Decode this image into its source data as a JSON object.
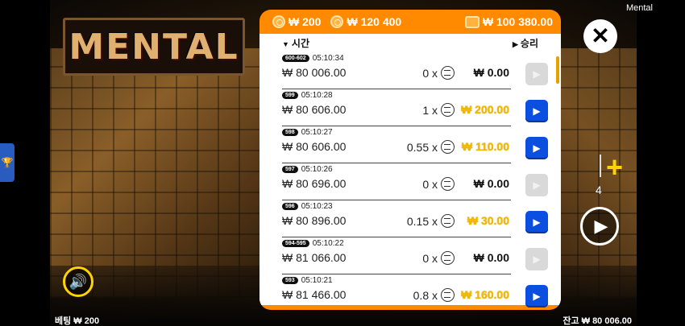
{
  "app_title": "Mental",
  "logo_text": "MENTAL",
  "header": {
    "bet_amount": "₩ 200",
    "total_amount": "₩ 120 400",
    "wallet_amount": "₩ 100 380.00"
  },
  "columns": {
    "time": "시간",
    "win": "승리"
  },
  "rows": [
    {
      "id": "600-602",
      "time": "05:10:34",
      "amount": "₩ 80 006.00",
      "mult": "0 x",
      "win": "₩ 0.00",
      "gold": false,
      "replay": false
    },
    {
      "id": "599",
      "time": "05:10:28",
      "amount": "₩ 80 606.00",
      "mult": "1 x",
      "win": "₩ 200.00",
      "gold": true,
      "replay": true
    },
    {
      "id": "598",
      "time": "05:10:27",
      "amount": "₩ 80 606.00",
      "mult": "0.55 x",
      "win": "₩ 110.00",
      "gold": true,
      "replay": true
    },
    {
      "id": "597",
      "time": "05:10:26",
      "amount": "₩ 80 696.00",
      "mult": "0 x",
      "win": "₩ 0.00",
      "gold": false,
      "replay": false
    },
    {
      "id": "596",
      "time": "05:10:23",
      "amount": "₩ 80 896.00",
      "mult": "0.15 x",
      "win": "₩ 30.00",
      "gold": true,
      "replay": true
    },
    {
      "id": "594-595",
      "time": "05:10:22",
      "amount": "₩ 81 066.00",
      "mult": "0 x",
      "win": "₩ 0.00",
      "gold": false,
      "replay": false
    },
    {
      "id": "593",
      "time": "05:10:21",
      "amount": "₩ 81 466.00",
      "mult": "0.8 x",
      "win": "₩ 160.00",
      "gold": true,
      "replay": true
    }
  ],
  "stake_level": "4",
  "footer": {
    "bet_label": "베팅 ₩ 200",
    "balance_label": "잔고 ₩ 80 006.00"
  },
  "icons": {
    "close": "close-icon",
    "plus": "plus-icon",
    "play": "play-icon",
    "sound": "sound-icon",
    "trophy": "trophy-icon"
  },
  "colors": {
    "panel_orange": "#ff8a00",
    "replay_blue": "#0a4fe0",
    "win_gold": "#f2b800",
    "accent_yellow": "#ffd400"
  }
}
